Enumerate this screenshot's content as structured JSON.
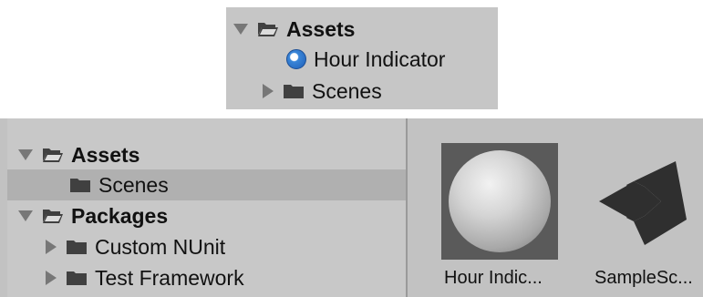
{
  "top_tree": {
    "assets_label": "Assets",
    "material_label": "Hour Indicator",
    "scenes_label": "Scenes"
  },
  "project_tree": {
    "assets_label": "Assets",
    "scenes_label": "Scenes",
    "packages_label": "Packages",
    "custom_nunit_label": "Custom NUnit",
    "test_framework_label": "Test Framework"
  },
  "asset_grid": {
    "items": [
      {
        "label": "Hour Indic...",
        "icon": "material-sphere-icon"
      },
      {
        "label": "SampleSc...",
        "icon": "unity-scene-icon"
      }
    ]
  },
  "colors": {
    "panel_bg": "#c6c6c6",
    "selection": "#b0b0b0",
    "material_blue": "#3a86d8"
  }
}
